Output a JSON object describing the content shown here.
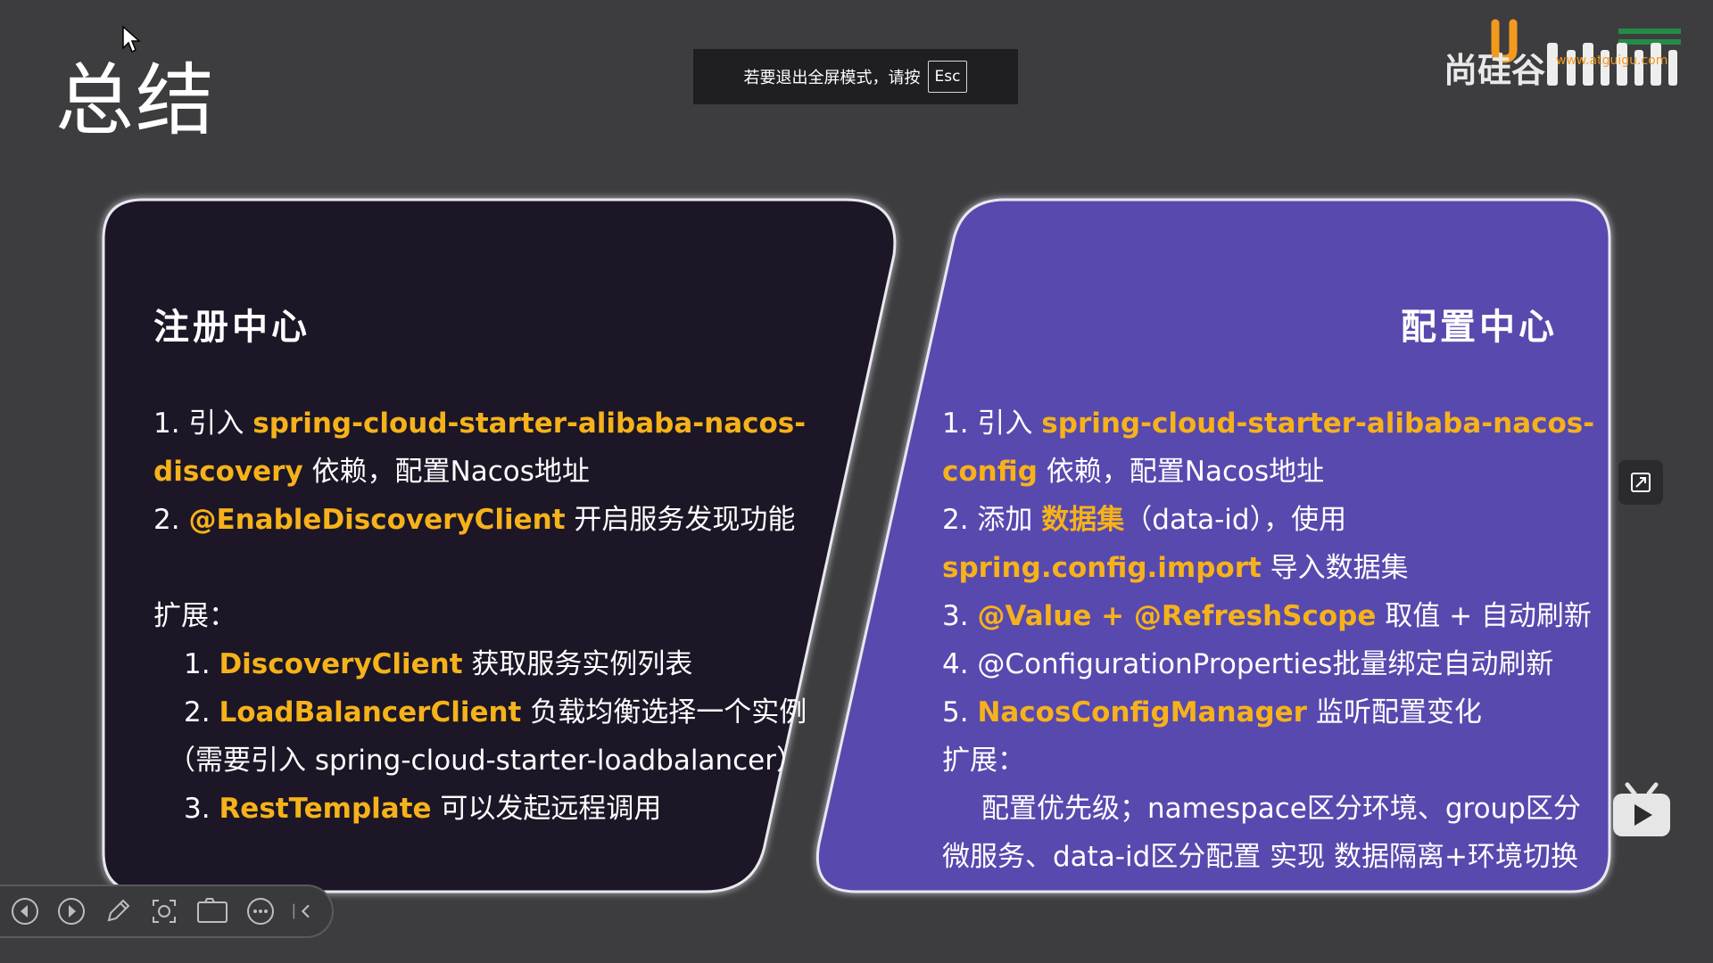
{
  "slide": {
    "title": "总结"
  },
  "toast": {
    "message": "若要退出全屏模式，请按",
    "key": "Esc"
  },
  "brand": {
    "name": "尚硅谷",
    "url": "www.atguigu.com",
    "platform": "bilibili"
  },
  "left_panel": {
    "heading": "注册中心",
    "items": [
      {
        "prefix": "1. 引入 ",
        "highlight": "spring-cloud-starter-alibaba-nacos-",
        "suffix": ""
      },
      {
        "prefix": "",
        "highlight": "discovery",
        "suffix": " 依赖，配置Nacos地址"
      },
      {
        "prefix": "2. ",
        "highlight": "@EnableDiscoveryClient",
        "suffix": " 开启服务发现功能"
      }
    ],
    "ext_label": "扩展：",
    "ext_items": [
      {
        "prefix": "1. ",
        "highlight": "DiscoveryClient",
        "suffix": " 获取服务实例列表"
      },
      {
        "prefix": "2. ",
        "highlight": "LoadBalancerClient",
        "suffix": " 负载均衡选择一个实例"
      },
      {
        "prefix": "（需要引入 spring-cloud-starter-loadbalancer）",
        "highlight": "",
        "suffix": ""
      },
      {
        "prefix": "3. ",
        "highlight": "RestTemplate",
        "suffix": " 可以发起远程调用"
      }
    ]
  },
  "right_panel": {
    "heading": "配置中心",
    "items": [
      {
        "prefix": "1. 引入 ",
        "highlight": "spring-cloud-starter-alibaba-nacos-",
        "suffix": ""
      },
      {
        "prefix": "",
        "highlight": "config",
        "suffix": " 依赖，配置Nacos地址"
      },
      {
        "prefix": "2. 添加 ",
        "highlight": "数据集",
        "suffix": "（data-id），使用"
      },
      {
        "prefix": "",
        "highlight": "spring.config.import",
        "suffix": " 导入数据集"
      },
      {
        "prefix": "3. ",
        "highlight": "@Value + @RefreshScope",
        "suffix": " 取值 + 自动刷新"
      },
      {
        "prefix": "4. @ConfigurationProperties批量绑定自动刷新",
        "highlight": "",
        "suffix": ""
      },
      {
        "prefix": "5. ",
        "highlight": "NacosConfigManager",
        "suffix": " 监听配置变化"
      }
    ],
    "ext_label": "扩展：",
    "ext_lines": [
      "配置优先级；namespace区分环境、group区分",
      "微服务、data-id区分配置 实现 数据隔离+环境切换"
    ]
  },
  "colors": {
    "background": "#3d3d3f",
    "left_panel": "#1c1526",
    "right_panel": "#5949ae",
    "highlight": "#f6b21a"
  }
}
